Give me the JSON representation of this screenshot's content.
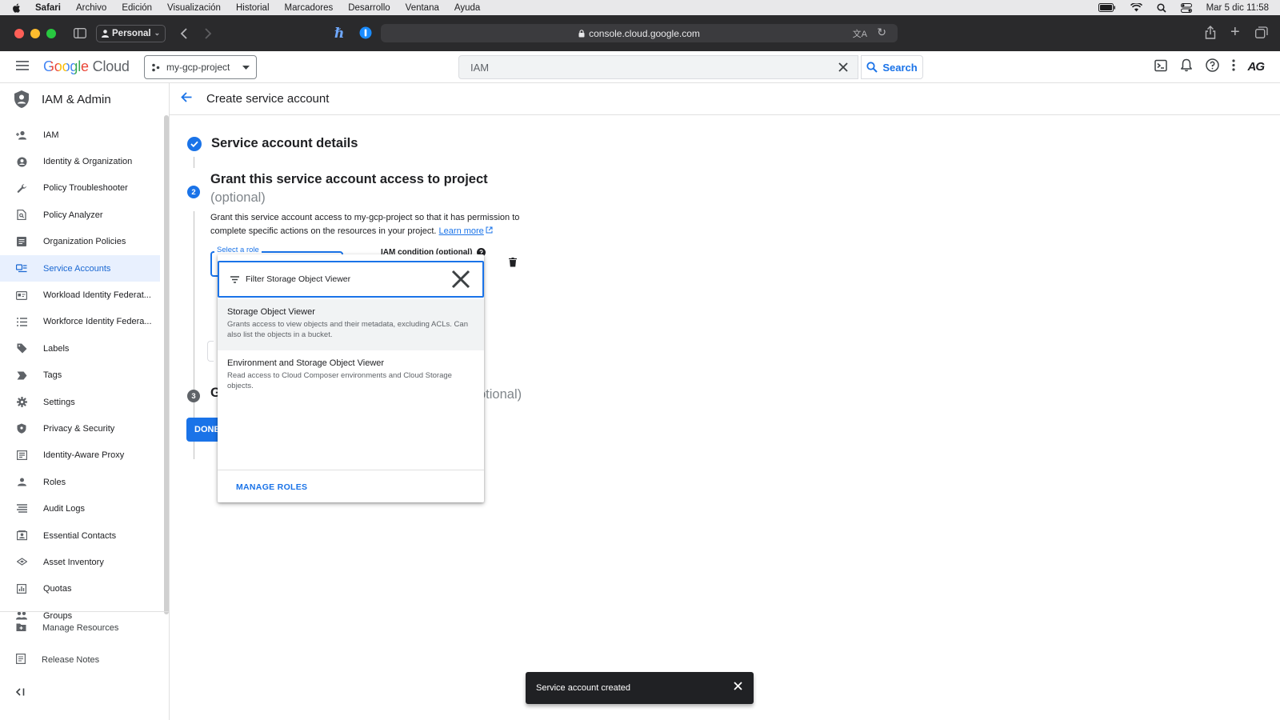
{
  "menubar": {
    "app": "Safari",
    "items": [
      "Archivo",
      "Edición",
      "Visualización",
      "Historial",
      "Marcadores",
      "Desarrollo",
      "Ventana",
      "Ayuda"
    ],
    "clock": "Mar 5 dic  11:58"
  },
  "browser": {
    "profile": "Personal",
    "url": "console.cloud.google.com"
  },
  "header": {
    "logo_google": "Google",
    "logo_cloud": "Cloud",
    "project": "my-gcp-project",
    "search_value": "IAM",
    "search_button": "Search",
    "avatar": "AG"
  },
  "sidebar": {
    "title": "IAM & Admin",
    "items": [
      {
        "label": "IAM",
        "icon": "person-add-icon"
      },
      {
        "label": "Identity & Organization",
        "icon": "account-circle-icon"
      },
      {
        "label": "Policy Troubleshooter",
        "icon": "wrench-icon"
      },
      {
        "label": "Policy Analyzer",
        "icon": "document-search-icon"
      },
      {
        "label": "Organization Policies",
        "icon": "list-box-icon"
      },
      {
        "label": "Service Accounts",
        "icon": "service-account-icon"
      },
      {
        "label": "Workload Identity Federat...",
        "icon": "id-card-icon"
      },
      {
        "label": "Workforce Identity Federa...",
        "icon": "list-icon"
      },
      {
        "label": "Labels",
        "icon": "tag-icon"
      },
      {
        "label": "Tags",
        "icon": "label-arrow-icon"
      },
      {
        "label": "Settings",
        "icon": "gear-icon"
      },
      {
        "label": "Privacy & Security",
        "icon": "shield-icon"
      },
      {
        "label": "Identity-Aware Proxy",
        "icon": "proxy-icon"
      },
      {
        "label": "Roles",
        "icon": "roles-icon"
      },
      {
        "label": "Audit Logs",
        "icon": "lines-icon"
      },
      {
        "label": "Essential Contacts",
        "icon": "contacts-icon"
      },
      {
        "label": "Asset Inventory",
        "icon": "layers-icon"
      },
      {
        "label": "Quotas",
        "icon": "quota-icon"
      },
      {
        "label": "Groups",
        "icon": "groups-icon"
      }
    ],
    "active_index": 5,
    "footer": {
      "manage_resources": "Manage Resources",
      "release_notes": "Release Notes"
    }
  },
  "page": {
    "title": "Create service account",
    "step1_title": "Service account details",
    "step2_number": "2",
    "step2_title": "Grant this service account access to project",
    "step2_optional": "(optional)",
    "step2_desc": "Grant this service account access to my-gcp-project so that it has permission to complete specific actions on the resources in your project.",
    "learn_more": "Learn more",
    "role_label": "Select a role",
    "iam_condition": "IAM condition (optional)",
    "step3_number": "3",
    "step3_fragment": "G",
    "step3_optional_fragment": "otional)",
    "done_button": "DONE"
  },
  "dropdown": {
    "filter_text": "Filter Storage Object Viewer",
    "options": [
      {
        "name": "Storage Object Viewer",
        "description": "Grants access to view objects and their metadata, excluding ACLs. Can also list the objects in a bucket."
      },
      {
        "name": "Environment and Storage Object Viewer",
        "description": "Read access to Cloud Composer environments and Cloud Storage objects."
      }
    ],
    "manage_roles": "MANAGE ROLES"
  },
  "snackbar": {
    "message": "Service account created"
  },
  "colors": {
    "accent": "#1a73e8",
    "active_nav_bg": "#e8f0fe"
  }
}
